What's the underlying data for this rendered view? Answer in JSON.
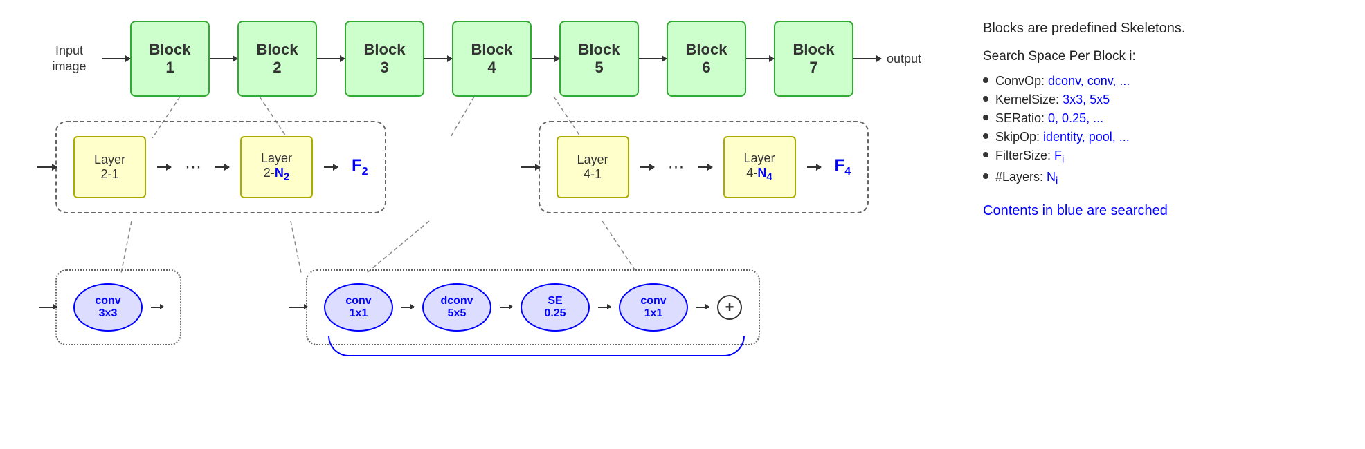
{
  "header": {
    "input_label": "Input\nimage",
    "output_label": "output",
    "arrow_text": "→"
  },
  "blocks": [
    {
      "id": 1,
      "line1": "Block",
      "line2": "1"
    },
    {
      "id": 2,
      "line1": "Block",
      "line2": "2"
    },
    {
      "id": 3,
      "line1": "Block",
      "line2": "3"
    },
    {
      "id": 4,
      "line1": "Block",
      "line2": "4"
    },
    {
      "id": 5,
      "line1": "Block",
      "line2": "5"
    },
    {
      "id": 6,
      "line1": "Block",
      "line2": "6"
    },
    {
      "id": 7,
      "line1": "Block",
      "line2": "7"
    }
  ],
  "layer_group1": {
    "layer1": {
      "line1": "Layer",
      "line2": "2-1"
    },
    "layer2_line1": "Layer",
    "layer2_line2": "2-",
    "layer2_bold": "N",
    "layer2_sub": "2",
    "f_label": "F",
    "f_sub": "2"
  },
  "layer_group2": {
    "layer1": {
      "line1": "Layer",
      "line2": "4-1"
    },
    "layer2_line1": "Layer",
    "layer2_line2": "4-",
    "layer2_bold": "N",
    "layer2_sub": "4",
    "f_label": "F",
    "f_sub": "4"
  },
  "ops_group1": {
    "ops": [
      {
        "line1": "conv",
        "line2": "3x3"
      }
    ]
  },
  "ops_group2": {
    "ops": [
      {
        "line1": "conv",
        "line2": "1x1"
      },
      {
        "line1": "dconv",
        "line2": "5x5"
      },
      {
        "line1": "SE",
        "line2": "0.25"
      },
      {
        "line1": "conv",
        "line2": "1x1"
      }
    ]
  },
  "right_panel": {
    "title": "Blocks are predefined Skeletons.",
    "subtitle": "Search Space Per Block i:",
    "bullets": [
      {
        "label": "ConvOp:",
        "value": "dconv, conv, ...",
        "value_blue": true
      },
      {
        "label": "KernelSize:",
        "value": "3x3, 5x5",
        "value_blue": true
      },
      {
        "label": "SERatio:",
        "value": "0, 0.25, ...",
        "value_blue": true
      },
      {
        "label": "SkipOp:",
        "value": "identity, pool, ...",
        "value_blue": true
      },
      {
        "label": "FilterSize:",
        "value": "F",
        "value_sub": "i",
        "value_blue": true
      },
      {
        "label": "#Layers:",
        "value": "N",
        "value_sub": "i",
        "value_blue": true
      }
    ],
    "note": "Contents in blue are searched"
  }
}
